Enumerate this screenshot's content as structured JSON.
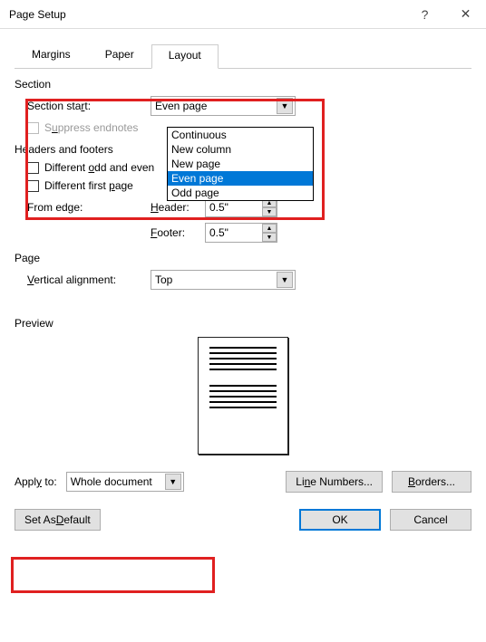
{
  "titlebar": {
    "title": "Page Setup"
  },
  "tabs": {
    "margins": "Margins",
    "paper": "Paper",
    "layout": "Layout"
  },
  "section": {
    "heading": "Section",
    "start_label": "Section start:",
    "start_value": "Even page",
    "suppress": "Suppress endnotes",
    "options": [
      "Continuous",
      "New column",
      "New page",
      "Even page",
      "Odd page"
    ],
    "selected_index": 3
  },
  "headers": {
    "heading": "Headers and footers",
    "diff_odd_even": "Different odd and even",
    "diff_first": "Different first page",
    "from_edge": "From edge:",
    "header_label": "Header:",
    "footer_label": "Footer:",
    "header_value": "0.5\"",
    "footer_value": "0.5\""
  },
  "page": {
    "heading": "Page",
    "valign_label": "Vertical alignment:",
    "valign_value": "Top"
  },
  "preview": {
    "heading": "Preview"
  },
  "apply": {
    "label": "Apply to:",
    "value": "Whole document"
  },
  "buttons": {
    "line_numbers": "Line Numbers...",
    "borders": "Borders...",
    "set_default": "Set As Default",
    "ok": "OK",
    "cancel": "Cancel"
  }
}
